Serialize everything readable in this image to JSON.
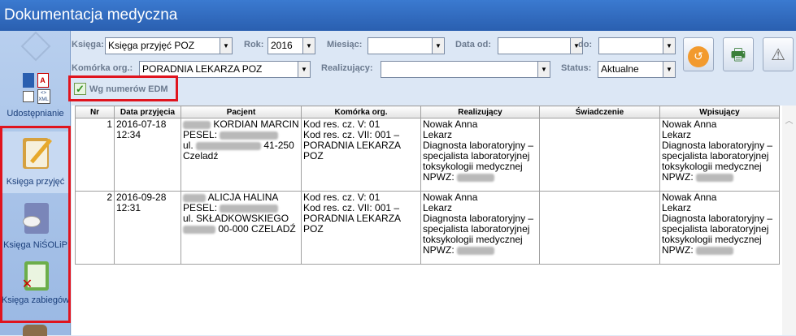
{
  "app": {
    "title": "Dokumentacja medyczna"
  },
  "sidebar": {
    "items": [
      {
        "label": "Udostępnianie",
        "icon": "pdf-xml-icon"
      },
      {
        "label": "Księga przyjęć",
        "icon": "admission-book-icon"
      },
      {
        "label": "Księga NiŚOLiP",
        "icon": "nisolip-book-icon"
      },
      {
        "label": "Księga zabiegów",
        "icon": "procedures-book-icon"
      }
    ]
  },
  "filters": {
    "ksiega_label": "Księga:",
    "ksiega_value": "Księga przyjęć POZ",
    "rok_label": "Rok:",
    "rok_value": "2016",
    "miesiac_label": "Miesiąc:",
    "miesiac_value": "",
    "data_od_label": "Data od:",
    "data_od_value": "",
    "do_label": "do:",
    "do_value": "",
    "komorka_label": "Komórka org.:",
    "komorka_value": "PORADNIA LEKARZA POZ",
    "realizujacy_label": "Realizujący:",
    "realizujacy_value": "",
    "status_label": "Status:",
    "status_value": "Aktualne",
    "edm_label": "Wg numerów EDM"
  },
  "table": {
    "columns": [
      "Nr",
      "Data przyjęcia",
      "Pacjent",
      "Komórka org.",
      "Realizujący",
      "Świadczenie",
      "Wpisujący"
    ],
    "rows": [
      {
        "nr": "1",
        "data": "2016-07-18 12:34",
        "pacjent_name": "KORDIAN MARCIN",
        "pacjent_pesel": "PESEL:",
        "pacjent_addr1": "ul.",
        "pacjent_addr2": "41-250 Czeladź",
        "komorka_1": "Kod res. cz. V: 01",
        "komorka_2": "Kod res. cz. VII: 001 – PORADNIA LEKARZA POZ",
        "real_name": "Nowak Anna",
        "real_role": "Lekarz",
        "real_spec": "Diagnosta laboratoryjny – specjalista laboratoryjnej toksykologii medycznej",
        "real_npwz": "NPWZ:",
        "swiadczenie": "",
        "wp_name": "Nowak Anna",
        "wp_role": "Lekarz",
        "wp_spec": "Diagnosta laboratoryjny – specjalista laboratoryjnej toksykologii medycznej",
        "wp_npwz": "NPWZ:"
      },
      {
        "nr": "2",
        "data": "2016-09-28 12:31",
        "pacjent_name": "ALICJA HALINA",
        "pacjent_pesel": "PESEL:",
        "pacjent_addr1": "ul. SKŁADKOWSKIEGO",
        "pacjent_addr2": "00-000 CZELADŹ",
        "komorka_1": "Kod res. cz. V: 01",
        "komorka_2": "Kod res. cz. VII: 001 – PORADNIA LEKARZA POZ",
        "real_name": "Nowak Anna",
        "real_role": "Lekarz",
        "real_spec": "Diagnosta laboratoryjny – specjalista laboratoryjnej toksykologii medycznej",
        "real_npwz": "NPWZ:",
        "swiadczenie": "",
        "wp_name": "Nowak Anna",
        "wp_role": "Lekarz",
        "wp_spec": "Diagnosta laboratoryjny – specjalista laboratoryjnej toksykologii medycznej",
        "wp_npwz": "NPWZ:"
      }
    ]
  },
  "colors": {
    "highlight": "#e0141e",
    "title_bar": "#2f69bd",
    "sidebar": "#a9c3ea"
  }
}
